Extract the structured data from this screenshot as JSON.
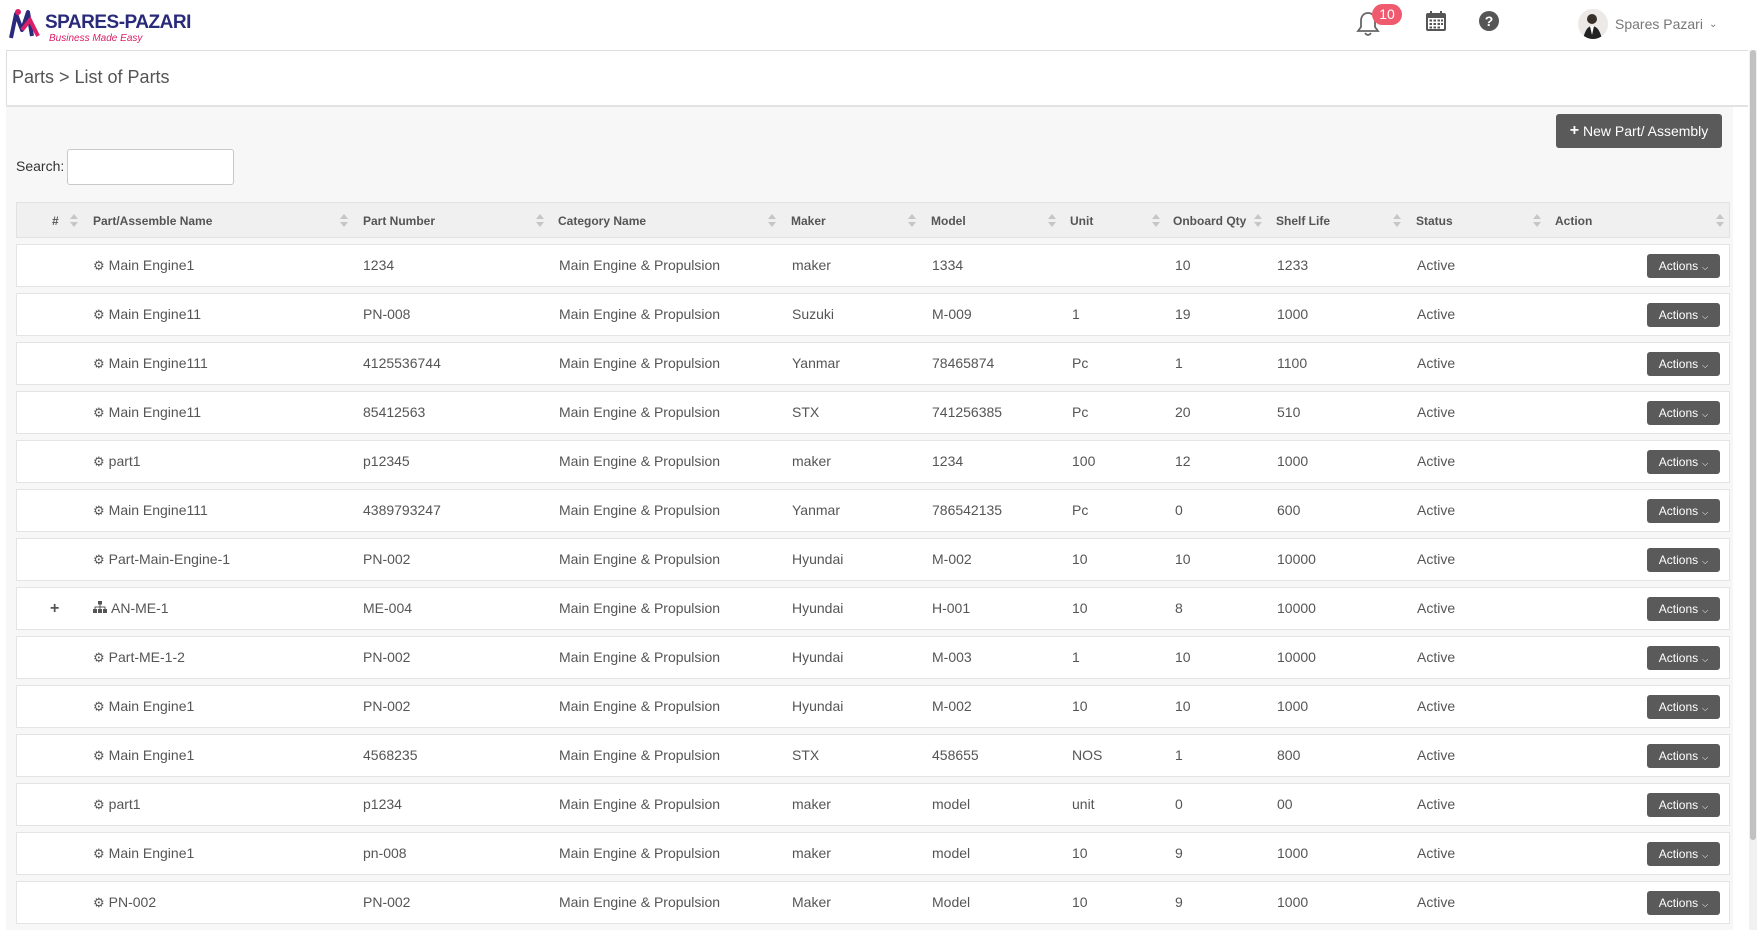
{
  "header": {
    "brand": "SPARES-PAZARI",
    "tagline": "Business Made Easy",
    "notification_count": "10",
    "user_name": "Spares Pazari"
  },
  "page": {
    "breadcrumb": "Parts > List of Parts",
    "new_button_label": "New Part/ Assembly",
    "search_label": "Search:",
    "search_value": ""
  },
  "table": {
    "columns": [
      "#",
      "Part/Assemble Name",
      "Part Number",
      "Category Name",
      "Maker",
      "Model",
      "Unit",
      "Onboard Qty",
      "Shelf Life",
      "Status",
      "Action"
    ],
    "action_label": "Actions",
    "rows": [
      {
        "type": "part",
        "expand": "",
        "name": "Main Engine1",
        "part_number": "1234",
        "category": "Main Engine & Propulsion",
        "maker": "maker",
        "model": "1334",
        "unit": "",
        "onboard_qty": "10",
        "shelf_life": "1233",
        "status": "Active"
      },
      {
        "type": "part",
        "expand": "",
        "name": "Main Engine11",
        "part_number": "PN-008",
        "category": "Main Engine & Propulsion",
        "maker": "Suzuki",
        "model": "M-009",
        "unit": "1",
        "onboard_qty": "19",
        "shelf_life": "1000",
        "status": "Active"
      },
      {
        "type": "part",
        "expand": "",
        "name": "Main Engine111",
        "part_number": "4125536744",
        "category": "Main Engine & Propulsion",
        "maker": "Yanmar",
        "model": "78465874",
        "unit": "Pc",
        "onboard_qty": "1",
        "shelf_life": "1100",
        "status": "Active"
      },
      {
        "type": "part",
        "expand": "",
        "name": "Main Engine11",
        "part_number": "85412563",
        "category": "Main Engine & Propulsion",
        "maker": "STX",
        "model": "741256385",
        "unit": "Pc",
        "onboard_qty": "20",
        "shelf_life": "510",
        "status": "Active"
      },
      {
        "type": "part",
        "expand": "",
        "name": "part1",
        "part_number": "p12345",
        "category": "Main Engine & Propulsion",
        "maker": "maker",
        "model": "1234",
        "unit": "100",
        "onboard_qty": "12",
        "shelf_life": "1000",
        "status": "Active"
      },
      {
        "type": "part",
        "expand": "",
        "name": "Main Engine111",
        "part_number": "4389793247",
        "category": "Main Engine & Propulsion",
        "maker": "Yanmar",
        "model": "786542135",
        "unit": "Pc",
        "onboard_qty": "0",
        "shelf_life": "600",
        "status": "Active"
      },
      {
        "type": "part",
        "expand": "",
        "name": "Part-Main-Engine-1",
        "part_number": "PN-002",
        "category": "Main Engine & Propulsion",
        "maker": "Hyundai",
        "model": "M-002",
        "unit": "10",
        "onboard_qty": "10",
        "shelf_life": "10000",
        "status": "Active"
      },
      {
        "type": "assembly",
        "expand": "+",
        "name": "AN-ME-1",
        "part_number": "ME-004",
        "category": "Main Engine & Propulsion",
        "maker": "Hyundai",
        "model": "H-001",
        "unit": "10",
        "onboard_qty": "8",
        "shelf_life": "10000",
        "status": "Active"
      },
      {
        "type": "part",
        "expand": "",
        "name": "Part-ME-1-2",
        "part_number": "PN-002",
        "category": "Main Engine & Propulsion",
        "maker": "Hyundai",
        "model": "M-003",
        "unit": "1",
        "onboard_qty": "10",
        "shelf_life": "10000",
        "status": "Active"
      },
      {
        "type": "part",
        "expand": "",
        "name": "Main Engine1",
        "part_number": "PN-002",
        "category": "Main Engine & Propulsion",
        "maker": "Hyundai",
        "model": "M-002",
        "unit": "10",
        "onboard_qty": "10",
        "shelf_life": "1000",
        "status": "Active"
      },
      {
        "type": "part",
        "expand": "",
        "name": "Main Engine1",
        "part_number": "4568235",
        "category": "Main Engine & Propulsion",
        "maker": "STX",
        "model": "458655",
        "unit": "NOS",
        "onboard_qty": "1",
        "shelf_life": "800",
        "status": "Active"
      },
      {
        "type": "part",
        "expand": "",
        "name": "part1",
        "part_number": "p1234",
        "category": "Main Engine & Propulsion",
        "maker": "maker",
        "model": "model",
        "unit": "unit",
        "onboard_qty": "0",
        "shelf_life": "00",
        "status": "Active"
      },
      {
        "type": "part",
        "expand": "",
        "name": "Main Engine1",
        "part_number": "pn-008",
        "category": "Main Engine & Propulsion",
        "maker": "maker",
        "model": "model",
        "unit": "10",
        "onboard_qty": "9",
        "shelf_life": "1000",
        "status": "Active"
      },
      {
        "type": "part",
        "expand": "",
        "name": "PN-002",
        "part_number": "PN-002",
        "category": "Main Engine & Propulsion",
        "maker": "Maker",
        "model": "Model",
        "unit": "10",
        "onboard_qty": "9",
        "shelf_life": "1000",
        "status": "Active"
      }
    ]
  },
  "icons": {
    "part": "gear-icon",
    "assembly": "sitemap-icon"
  }
}
